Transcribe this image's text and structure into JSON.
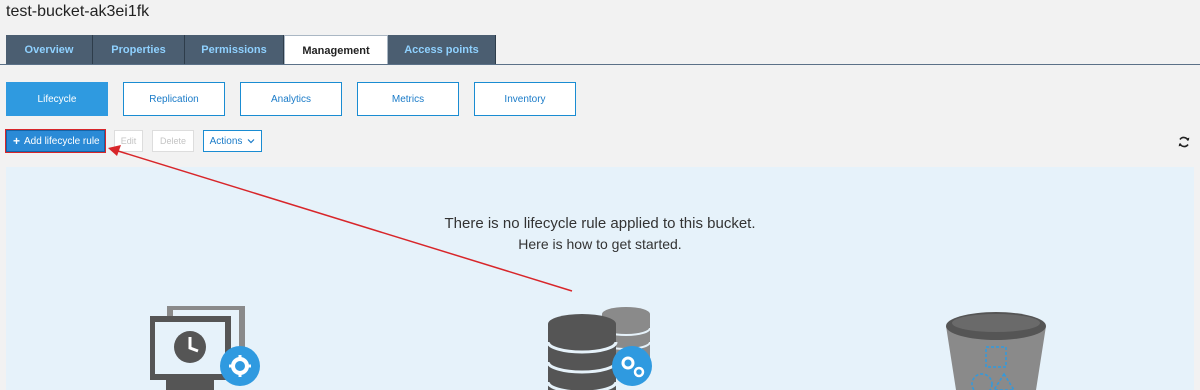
{
  "bucket": {
    "title": "test-bucket-ak3ei1fk"
  },
  "tabs": [
    {
      "label": "Overview",
      "active": false
    },
    {
      "label": "Properties",
      "active": false
    },
    {
      "label": "Permissions",
      "active": false
    },
    {
      "label": "Management",
      "active": true
    },
    {
      "label": "Access points",
      "active": false
    }
  ],
  "subtabs": [
    {
      "label": "Lifecycle",
      "active": true
    },
    {
      "label": "Replication",
      "active": false
    },
    {
      "label": "Analytics",
      "active": false
    },
    {
      "label": "Metrics",
      "active": false
    },
    {
      "label": "Inventory",
      "active": false
    }
  ],
  "toolbar": {
    "add_label": "Add lifecycle rule",
    "edit_label": "Edit",
    "delete_label": "Delete",
    "actions_label": "Actions"
  },
  "empty_state": {
    "line1": "There is no lifecycle rule applied to this bucket.",
    "line2": "Here is how to get started."
  },
  "icons": {
    "add": "plus-icon",
    "actions": "chevron-down-icon",
    "refresh": "refresh-icon",
    "illustrations": [
      "monitor-clock-gear-icon",
      "database-gear-icon",
      "bucket-objects-icon"
    ]
  },
  "colors": {
    "tab_bg": "#4b5e71",
    "tab_text": "#8fd1ff",
    "accent": "#2f9ae0",
    "panel_bg": "#e6f2fa",
    "annotation": "#d8262a"
  }
}
